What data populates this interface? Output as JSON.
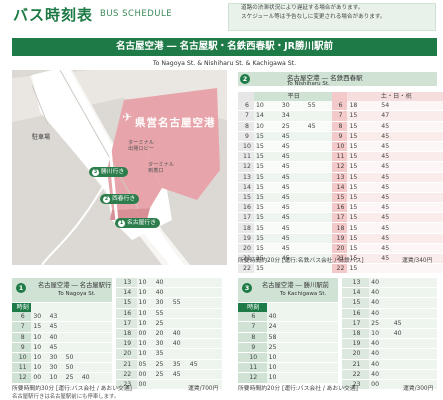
{
  "header": {
    "title": "バス時刻表",
    "subtitle": "BUS SCHEDULE",
    "notice": [
      "道路の渋滞状況により遅延する場合があります。",
      "スケジュール等は予告なしに変更される場合があります。"
    ]
  },
  "route_bar": "名古屋空港 ― 名古屋駅・名鉄西春駅・JR勝川駅前",
  "route_sub": "To Nagoya St. & Nishiharu St. & Kachigawa St.",
  "map": {
    "airport_name": "県営名古屋空港",
    "parking": "駐車場",
    "terminal_3f": "ターミナル\n出発ロビー",
    "terminal_1f": "ターミナル\n到着口",
    "stops": [
      {
        "num": "3",
        "label": "勝川行き"
      },
      {
        "num": "2",
        "label": "西春行き"
      },
      {
        "num": "1",
        "label": "名古屋行き"
      }
    ]
  },
  "colors": {
    "green": "#1e7a47",
    "light": "#cfe2d4",
    "weekend": "#e08a8a"
  },
  "nishiharu": {
    "num": "2",
    "title": "名古屋空港 ― 名鉄西春駅",
    "sub": "To Nishiharu St.",
    "col_weekday": "平日",
    "col_weekend": "土・日・祝",
    "weekday": [
      [
        "6",
        "10",
        "30",
        "55"
      ],
      [
        "7",
        "14",
        "34"
      ],
      [
        "8",
        "10",
        "25",
        "45"
      ],
      [
        "9",
        "15",
        "45"
      ],
      [
        "10",
        "15",
        "45"
      ],
      [
        "11",
        "15",
        "45"
      ],
      [
        "12",
        "15",
        "45"
      ],
      [
        "13",
        "15",
        "45"
      ],
      [
        "14",
        "15",
        "45"
      ],
      [
        "15",
        "15",
        "45"
      ],
      [
        "16",
        "15",
        "45"
      ],
      [
        "17",
        "15",
        "45"
      ],
      [
        "18",
        "15",
        "45"
      ],
      [
        "19",
        "15",
        "45"
      ],
      [
        "20",
        "15",
        "45"
      ],
      [
        "21",
        "15",
        "45"
      ],
      [
        "22",
        "15"
      ]
    ],
    "weekend": [
      [
        "6",
        "18",
        "54"
      ],
      [
        "7",
        "15",
        "47"
      ],
      [
        "8",
        "15",
        "45"
      ],
      [
        "9",
        "15",
        "45"
      ],
      [
        "10",
        "15",
        "45"
      ],
      [
        "11",
        "15",
        "45"
      ],
      [
        "12",
        "15",
        "45"
      ],
      [
        "13",
        "15",
        "45"
      ],
      [
        "14",
        "15",
        "45"
      ],
      [
        "15",
        "15",
        "45"
      ],
      [
        "16",
        "15",
        "45"
      ],
      [
        "17",
        "15",
        "45"
      ],
      [
        "18",
        "15",
        "45"
      ],
      [
        "19",
        "15",
        "45"
      ],
      [
        "20",
        "15",
        "45"
      ],
      [
        "21",
        "15",
        "45"
      ],
      [
        "22",
        "15"
      ]
    ],
    "note": "所要時間約20分 [運行:名鉄バス会社 / 名鉄バス]",
    "fare": "運賃/340円"
  },
  "nagoya": {
    "num": "1",
    "title": "名古屋空港 ― 名古屋駅行",
    "sub": "To Nagoya St.",
    "col_hour": "時刻",
    "left": [
      [
        "6",
        "30",
        "43"
      ],
      [
        "7",
        "15",
        "45"
      ],
      [
        "8",
        "10",
        "40"
      ],
      [
        "9",
        "10",
        "45"
      ],
      [
        "10",
        "10",
        "30",
        "50"
      ],
      [
        "11",
        "10",
        "30",
        "50"
      ],
      [
        "12",
        "00",
        "10",
        "25",
        "40"
      ]
    ],
    "right": [
      [
        "13",
        "10",
        "40"
      ],
      [
        "14",
        "10",
        "40"
      ],
      [
        "15",
        "10",
        "30",
        "55"
      ],
      [
        "16",
        "10",
        "55"
      ],
      [
        "17",
        "10",
        "25"
      ],
      [
        "18",
        "00",
        "20",
        "40"
      ],
      [
        "19",
        "10",
        "30",
        "40"
      ],
      [
        "20",
        "10",
        "35"
      ],
      [
        "21",
        "05",
        "25",
        "35",
        "45"
      ],
      [
        "22",
        "00",
        "25",
        "45"
      ],
      [
        "23",
        "00"
      ]
    ],
    "note": "所要時間約30分 [運行:バス会社 / あおい交通]",
    "fare": "運賃/700円",
    "foot": "名古屋駅行きは名古屋駅前にも停車します。"
  },
  "kachigawa": {
    "num": "3",
    "title": "名古屋空港 ― 勝川駅前",
    "sub": "To Kachigawa St.",
    "col_hour": "時刻",
    "left": [
      [
        "6",
        "40"
      ],
      [
        "7",
        "24"
      ],
      [
        "8",
        "58"
      ],
      [
        "9",
        "25"
      ],
      [
        "10",
        "10"
      ],
      [
        "11",
        "10"
      ],
      [
        "12",
        "10"
      ]
    ],
    "right": [
      [
        "13",
        "40"
      ],
      [
        "14",
        "40"
      ],
      [
        "15",
        "40"
      ],
      [
        "16",
        "40"
      ],
      [
        "17",
        "25",
        "45"
      ],
      [
        "18",
        "10",
        "40"
      ],
      [
        "19",
        "40"
      ],
      [
        "20",
        "40"
      ],
      [
        "21",
        "40"
      ],
      [
        "22",
        "40"
      ],
      [
        "23",
        "00"
      ]
    ],
    "note": "所要時間約20分 [運行:バス会社 / あおい交通]",
    "fare": "運賃/300円"
  }
}
